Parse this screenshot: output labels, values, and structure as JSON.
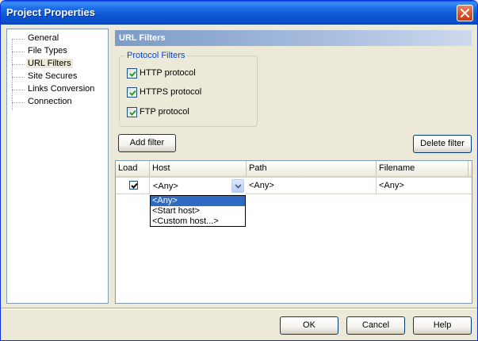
{
  "window": {
    "title": "Project Properties"
  },
  "tree": {
    "items": [
      {
        "label": "General",
        "selected": false
      },
      {
        "label": "File Types",
        "selected": false
      },
      {
        "label": "URL Filters",
        "selected": true
      },
      {
        "label": "Site Secures",
        "selected": false
      },
      {
        "label": "Links Conversion",
        "selected": false
      },
      {
        "label": "Connection",
        "selected": false
      }
    ]
  },
  "section": {
    "title": "URL Filters"
  },
  "protocol_filters": {
    "legend": "Protocol Filters",
    "options": [
      {
        "label": "HTTP protocol",
        "checked": true
      },
      {
        "label": "HTTPS protocol",
        "checked": true
      },
      {
        "label": "FTP protocol",
        "checked": true
      }
    ]
  },
  "buttons": {
    "add_filter": "Add filter",
    "delete_filter": "Delete filter",
    "ok": "OK",
    "cancel": "Cancel",
    "help": "Help"
  },
  "grid": {
    "columns": [
      "Load",
      "Host",
      "Path",
      "Filename"
    ],
    "rows": [
      {
        "load": true,
        "host": "<Any>",
        "path": "<Any>",
        "filename": "<Any>"
      }
    ],
    "host_dropdown": {
      "options": [
        "<Any>",
        "<Start host>",
        "<Custom host...>"
      ],
      "selected_index": 0
    }
  },
  "colors": {
    "title_bar": "#0a5fd8",
    "selection": "#316ac5",
    "legend_text": "#0046d5",
    "section_header": "#7c9bc6"
  }
}
